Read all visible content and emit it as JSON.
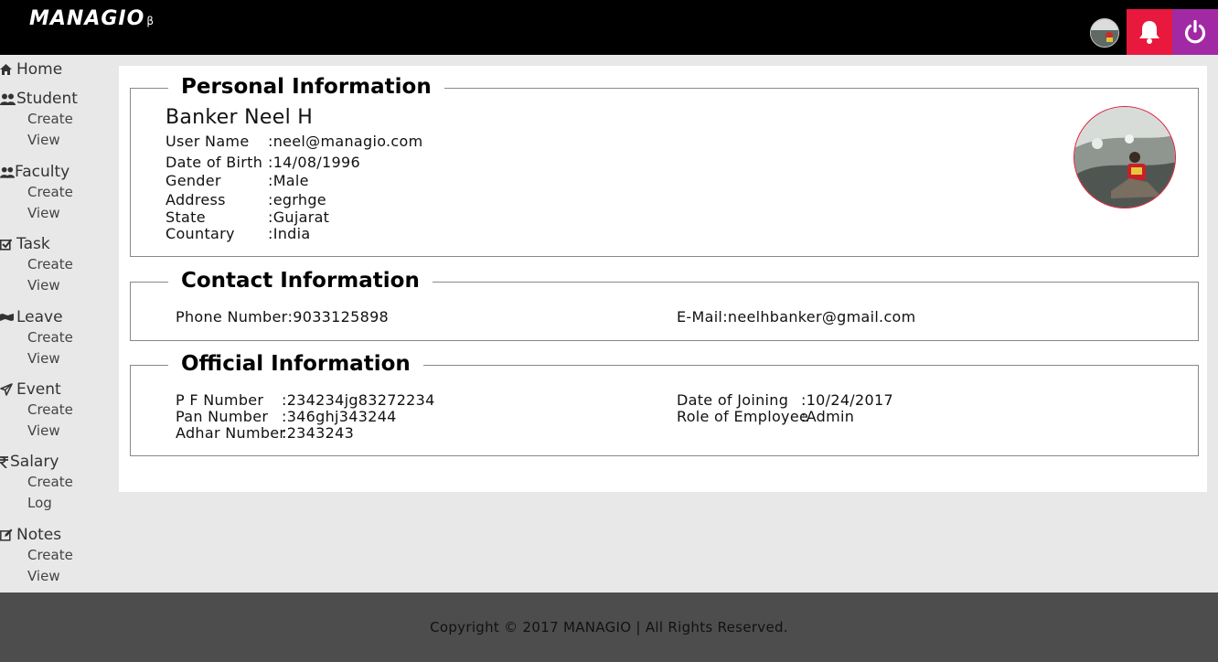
{
  "brand": {
    "logo": "MANAGIO",
    "beta": "β"
  },
  "header": {
    "bell_icon": "bell-icon",
    "power_icon": "power-icon",
    "bell_color": "#e8193c",
    "power_color": "#a12aa4"
  },
  "sidebar": {
    "home": {
      "label": "Home",
      "icon": "home-icon"
    },
    "groups": [
      {
        "label": "Student",
        "icon": "users-icon",
        "items": [
          "Create",
          "View"
        ]
      },
      {
        "label": "Faculty",
        "icon": "users-icon",
        "items": [
          "Create",
          "View"
        ]
      },
      {
        "label": "Task",
        "icon": "check-square-icon",
        "items": [
          "Create",
          "View"
        ]
      },
      {
        "label": "Leave",
        "icon": "flag-icon",
        "items": [
          "Create",
          "View"
        ]
      },
      {
        "label": "Event",
        "icon": "paper-plane-icon",
        "items": [
          "Create",
          "View"
        ]
      },
      {
        "label": "Salary",
        "icon": "rupee-icon",
        "items": [
          "Create",
          "Log"
        ]
      },
      {
        "label": "Notes",
        "icon": "edit-icon",
        "items": [
          "Create",
          "View"
        ]
      }
    ]
  },
  "personal": {
    "title": "Personal Information",
    "name": "Banker Neel H",
    "fields": [
      {
        "label": "User Name",
        "value": "neel@managio.com"
      },
      {
        "label": "Date of Birth",
        "value": "14/08/1996"
      },
      {
        "label": "Gender",
        "value": "Male"
      },
      {
        "label": "Address",
        "value": "egrhge"
      },
      {
        "label": "State",
        "value": "Gujarat"
      },
      {
        "label": "Countary",
        "value": "India"
      }
    ]
  },
  "contact": {
    "title": "Contact Information",
    "phone_label": "Phone Number",
    "phone": "9033125898",
    "email_label": "E-Mail",
    "email": "neelhbanker@gmail.com"
  },
  "official": {
    "title": "Official Information",
    "left": [
      {
        "label": "P F Number",
        "value": "234234jg83272234"
      },
      {
        "label": "Pan Number",
        "value": "346ghj343244"
      },
      {
        "label": "Adhar Number",
        "value": "2343243"
      }
    ],
    "right": [
      {
        "label": "Date of Joining",
        "value": "10/24/2017"
      },
      {
        "label": "Role of Employee",
        "value": "Admin"
      }
    ]
  },
  "footer": {
    "text": "Copyright © 2017 MANAGIO | All Rights Reserved."
  }
}
